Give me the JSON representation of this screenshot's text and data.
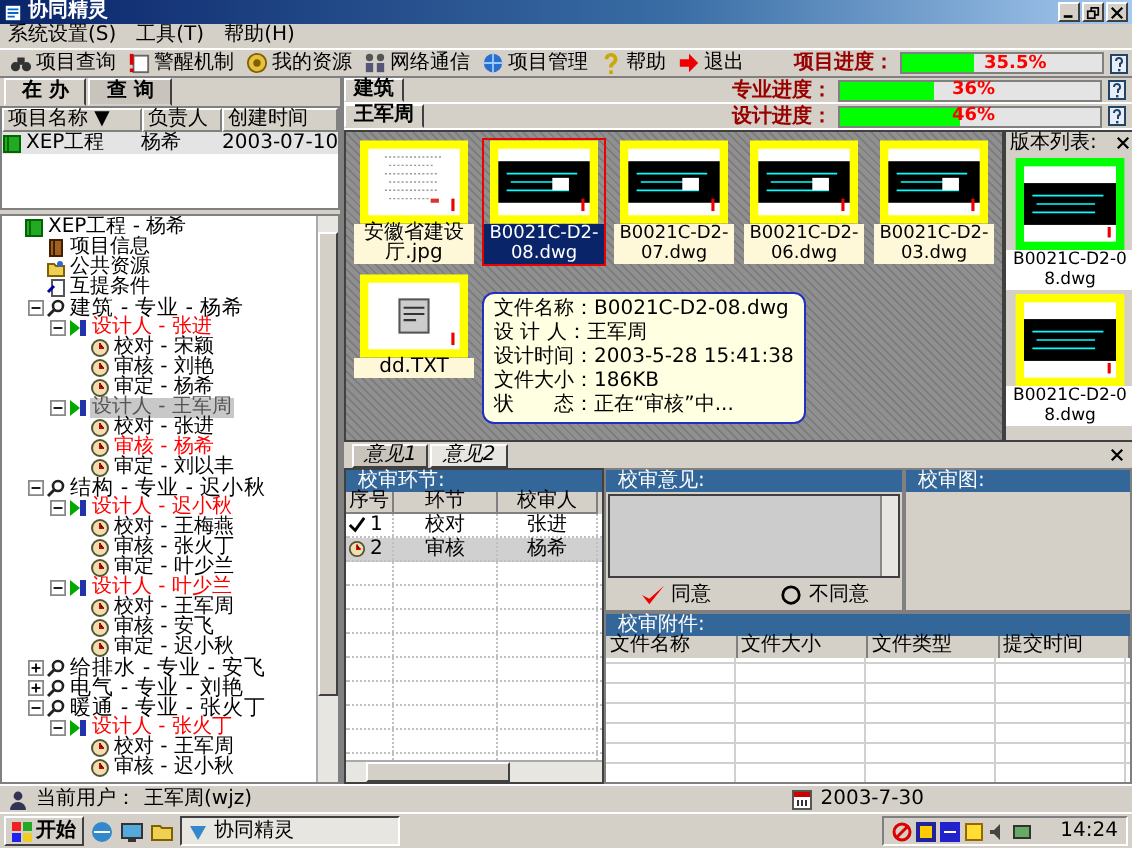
{
  "window": {
    "title": "协同精灵"
  },
  "menu": [
    "系统设置(S)",
    "工具(T)",
    "帮助(H)"
  ],
  "toolbar": [
    {
      "label": "项目查询",
      "kind": "search"
    },
    {
      "label": "警醒机制",
      "kind": "alert"
    },
    {
      "label": "我的资源",
      "kind": "resource"
    },
    {
      "label": "网络通信",
      "kind": "network"
    },
    {
      "label": "项目管理",
      "kind": "manage"
    },
    {
      "label": "帮助",
      "kind": "help"
    },
    {
      "label": "退出",
      "kind": "exit"
    }
  ],
  "progress": [
    {
      "label": "项目进度：",
      "level": 0.355,
      "reading": "35.5%"
    },
    {
      "label": "专业进度：",
      "level": 0.36,
      "reading": "36%"
    },
    {
      "label": "设计进度：",
      "level": 0.46,
      "reading": "46%"
    }
  ],
  "left_tabs": [
    {
      "label": "在 办",
      "selected": true
    },
    {
      "label": "查 询",
      "selected": false
    }
  ],
  "project_table": {
    "columns": [
      "项目名称 ▼",
      "负责人",
      "创建时间"
    ],
    "rows": [
      {
        "cells": [
          "XEP工程",
          "杨希",
          "2003-07-10"
        ],
        "selected": true
      }
    ]
  },
  "tree": [
    {
      "text": "XEP工程 - 杨希",
      "kind": "project",
      "selected": false,
      "highlighted": false,
      "children": [
        {
          "text": "项目信息",
          "kind": "info",
          "selected": false,
          "highlighted": false
        },
        {
          "text": "公共资源",
          "kind": "resource",
          "selected": false,
          "highlighted": false
        },
        {
          "text": "互提条件",
          "kind": "condition",
          "selected": false,
          "highlighted": false
        },
        {
          "text": "建筑 - 专业 - 杨希",
          "kind": "discipline",
          "selected": false,
          "highlighted": false,
          "expanded": true,
          "children": [
            {
              "text": "设计人 - 张进",
              "kind": "designer",
              "selected": false,
              "highlighted": true,
              "expanded": true,
              "children": [
                {
                  "text": "校对 - 宋颖",
                  "kind": "review",
                  "selected": false,
                  "highlighted": false
                },
                {
                  "text": "审核 - 刘艳",
                  "kind": "review",
                  "selected": false,
                  "highlighted": false
                },
                {
                  "text": "审定 - 杨希",
                  "kind": "review",
                  "selected": false,
                  "highlighted": false
                }
              ]
            },
            {
              "text": "设计人 - 王军周",
              "kind": "designer",
              "selected": true,
              "highlighted": false,
              "expanded": true,
              "children": [
                {
                  "text": "校对 - 张进",
                  "kind": "review",
                  "selected": false,
                  "highlighted": false
                },
                {
                  "text": "审核 - 杨希",
                  "kind": "review",
                  "selected": false,
                  "highlighted": true
                },
                {
                  "text": "审定 - 刘以丰",
                  "kind": "review",
                  "selected": false,
                  "highlighted": false
                }
              ]
            }
          ]
        },
        {
          "text": "结构 - 专业 - 迟小秋",
          "kind": "discipline",
          "selected": false,
          "highlighted": false,
          "expanded": true,
          "children": [
            {
              "text": "设计人 - 迟小秋",
              "kind": "designer",
              "selected": false,
              "highlighted": true,
              "expanded": true,
              "children": [
                {
                  "text": "校对 - 王梅燕",
                  "kind": "review",
                  "selected": false,
                  "highlighted": false
                },
                {
                  "text": "审核 - 张火丁",
                  "kind": "review",
                  "selected": false,
                  "highlighted": false
                },
                {
                  "text": "审定 - 叶少兰",
                  "kind": "review",
                  "selected": false,
                  "highlighted": false
                }
              ]
            },
            {
              "text": "设计人 - 叶少兰",
              "kind": "designer",
              "selected": false,
              "highlighted": true,
              "expanded": true,
              "children": [
                {
                  "text": "校对 - 王军周",
                  "kind": "review",
                  "selected": false,
                  "highlighted": false
                },
                {
                  "text": "审核 - 安飞",
                  "kind": "review",
                  "selected": false,
                  "highlighted": false
                },
                {
                  "text": "审定 - 迟小秋",
                  "kind": "review",
                  "selected": false,
                  "highlighted": false
                }
              ]
            }
          ]
        },
        {
          "text": "给排水 - 专业 - 安飞",
          "kind": "discipline",
          "selected": false,
          "highlighted": false,
          "expanded": false
        },
        {
          "text": "电气 - 专业 - 刘艳",
          "kind": "discipline",
          "selected": false,
          "highlighted": false,
          "expanded": false
        },
        {
          "text": "暖通 - 专业 - 张火丁",
          "kind": "discipline",
          "selected": false,
          "highlighted": false,
          "expanded": true,
          "children": [
            {
              "text": "设计人 - 张火丁",
              "kind": "designer",
              "selected": false,
              "highlighted": true,
              "expanded": true,
              "children": [
                {
                  "text": "校对 - 王军周",
                  "kind": "review",
                  "selected": false,
                  "highlighted": false
                },
                {
                  "text": "审核 - 迟小秋",
                  "kind": "review",
                  "selected": false,
                  "highlighted": false
                }
              ]
            }
          ]
        }
      ]
    }
  ],
  "discipline_tabs": [
    {
      "label": "建筑",
      "selected": true
    }
  ],
  "designer_tabs": [
    {
      "label": "王军周",
      "selected": true
    }
  ],
  "files": [
    {
      "name": "安徽省建设厅.jpg",
      "kind": "scan",
      "selected": false
    },
    {
      "name": "B0021C-D2-08.dwg",
      "kind": "cad",
      "selected": true
    },
    {
      "name": "B0021C-D2-07.dwg",
      "kind": "cad",
      "selected": false
    },
    {
      "name": "B0021C-D2-06.dwg",
      "kind": "cad",
      "selected": false
    },
    {
      "name": "B0021C-D2-03.dwg",
      "kind": "cad",
      "selected": false
    },
    {
      "name": "dd.TXT",
      "kind": "text",
      "selected": false
    }
  ],
  "file_tooltip": [
    "文件名称：B0021C-D2-08.dwg",
    "设 计 人：王军周",
    "设计时间：2003-5-28 15:41:38",
    "文件大小：186KB",
    "状　　态：正在“审核”中..."
  ],
  "versions": {
    "title": "版本列表:",
    "items": [
      {
        "name": "B0021C-D2-08.dwg",
        "color": "#00ff00"
      },
      {
        "name": "B0021C-D2-08.dwg",
        "color": "#ffff00"
      }
    ]
  },
  "opinion_tabs": [
    {
      "label": "意见1",
      "selected": false
    },
    {
      "label": "意见2",
      "selected": true
    }
  ],
  "steps": {
    "title": "校审环节:",
    "columns": [
      "序号",
      "环节",
      "校审人"
    ],
    "rows": [
      {
        "no": "1",
        "step": "校对",
        "person": "张进",
        "kind": "done",
        "selected": false
      },
      {
        "no": "2",
        "step": "审核",
        "person": "杨希",
        "kind": "pending",
        "selected": true
      }
    ]
  },
  "opinion": {
    "title": "校审意见:",
    "agree": "同意",
    "disagree": "不同意"
  },
  "review_drawing": {
    "title": "校审图:"
  },
  "attachments": {
    "title": "校审附件:",
    "columns": [
      "文件名称",
      "文件大小",
      "文件类型",
      "提交时间"
    ]
  },
  "status_bar": {
    "user_label": "当前用户：",
    "user": "王军周(wjz)",
    "date": "2003-7-30"
  },
  "taskbar": {
    "start": "开始",
    "tasks": [
      {
        "label": "协同精灵"
      }
    ],
    "clock": "14:24"
  }
}
